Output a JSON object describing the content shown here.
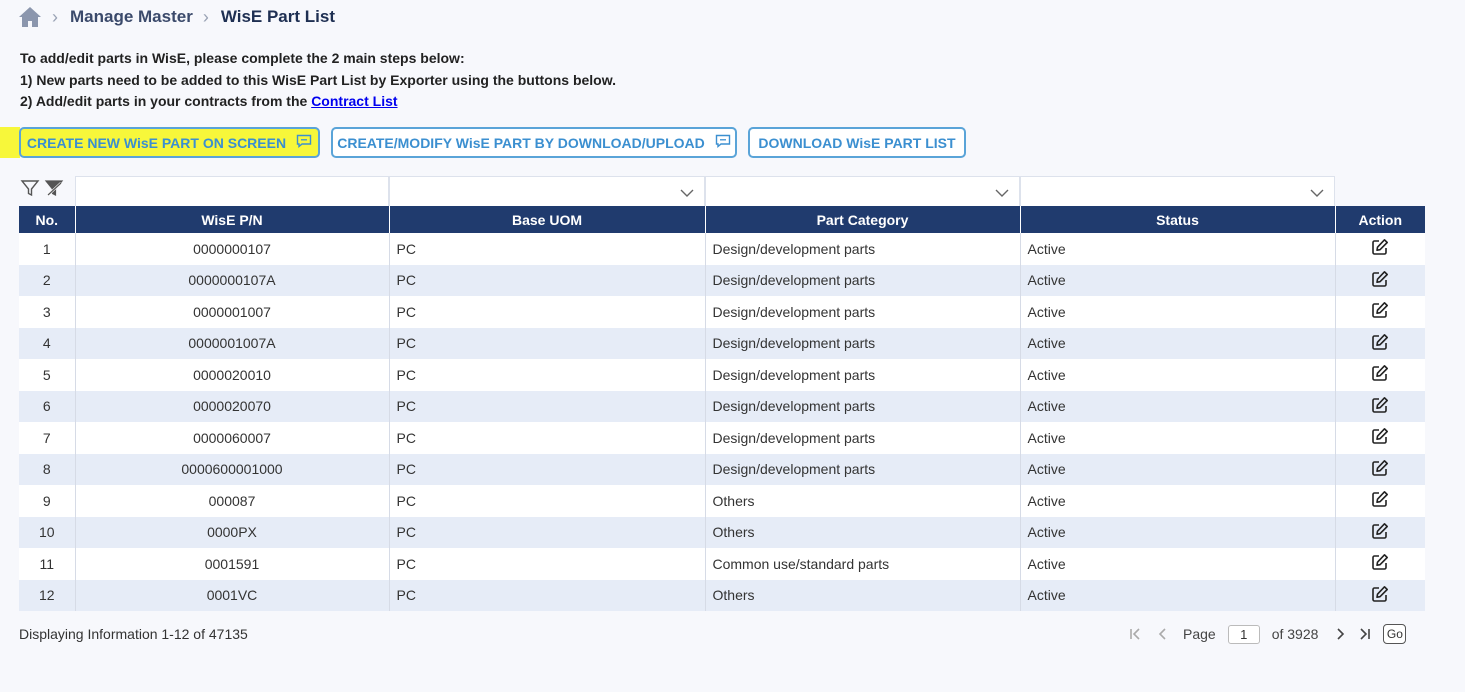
{
  "breadcrumb": {
    "items": [
      "Manage Master",
      "WisE Part List"
    ]
  },
  "intro": {
    "line1": "To add/edit parts in WisE, please complete the 2 main steps below:",
    "line2": "1) New parts need to be added to this WisE Part List by Exporter using the buttons below.",
    "line3_prefix": "2) Add/edit parts in your contracts from the ",
    "line3_link": "Contract List"
  },
  "buttons": {
    "create_new": "CREATE NEW WisE PART ON SCREEN",
    "create_modify": "CREATE/MODIFY WisE PART BY DOWNLOAD/UPLOAD",
    "download": "DOWNLOAD WisE PART LIST"
  },
  "table": {
    "headers": [
      "No.",
      "WisE P/N",
      "Base UOM",
      "Part Category",
      "Status",
      "Action"
    ],
    "rows": [
      {
        "no": "1",
        "pn": "0000000107",
        "uom": "PC",
        "category": "Design/development parts",
        "status": "Active"
      },
      {
        "no": "2",
        "pn": "0000000107A",
        "uom": "PC",
        "category": "Design/development parts",
        "status": "Active"
      },
      {
        "no": "3",
        "pn": "0000001007",
        "uom": "PC",
        "category": "Design/development parts",
        "status": "Active"
      },
      {
        "no": "4",
        "pn": "0000001007A",
        "uom": "PC",
        "category": "Design/development parts",
        "status": "Active"
      },
      {
        "no": "5",
        "pn": "0000020010",
        "uom": "PC",
        "category": "Design/development parts",
        "status": "Active"
      },
      {
        "no": "6",
        "pn": "0000020070",
        "uom": "PC",
        "category": "Design/development parts",
        "status": "Active"
      },
      {
        "no": "7",
        "pn": "0000060007",
        "uom": "PC",
        "category": "Design/development parts",
        "status": "Active"
      },
      {
        "no": "8",
        "pn": "0000600001000",
        "uom": "PC",
        "category": "Design/development parts",
        "status": "Active"
      },
      {
        "no": "9",
        "pn": "000087",
        "uom": "PC",
        "category": "Others",
        "status": "Active"
      },
      {
        "no": "10",
        "pn": "0000PX",
        "uom": "PC",
        "category": "Others",
        "status": "Active"
      },
      {
        "no": "11",
        "pn": "0001591",
        "uom": "PC",
        "category": "Common use/standard parts",
        "status": "Active"
      },
      {
        "no": "12",
        "pn": "0001VC",
        "uom": "PC",
        "category": "Others",
        "status": "Active"
      }
    ]
  },
  "footer": {
    "status": "Displaying Information 1-12 of 47135",
    "page_label": "Page",
    "page_value": "1",
    "of_label": "of 3928",
    "go_label": "Go"
  },
  "colors": {
    "header_bg": "#203b6e",
    "accent": "#3b8fd0",
    "highlight": "#f7f73a",
    "alt_row": "#e6ecf7"
  }
}
